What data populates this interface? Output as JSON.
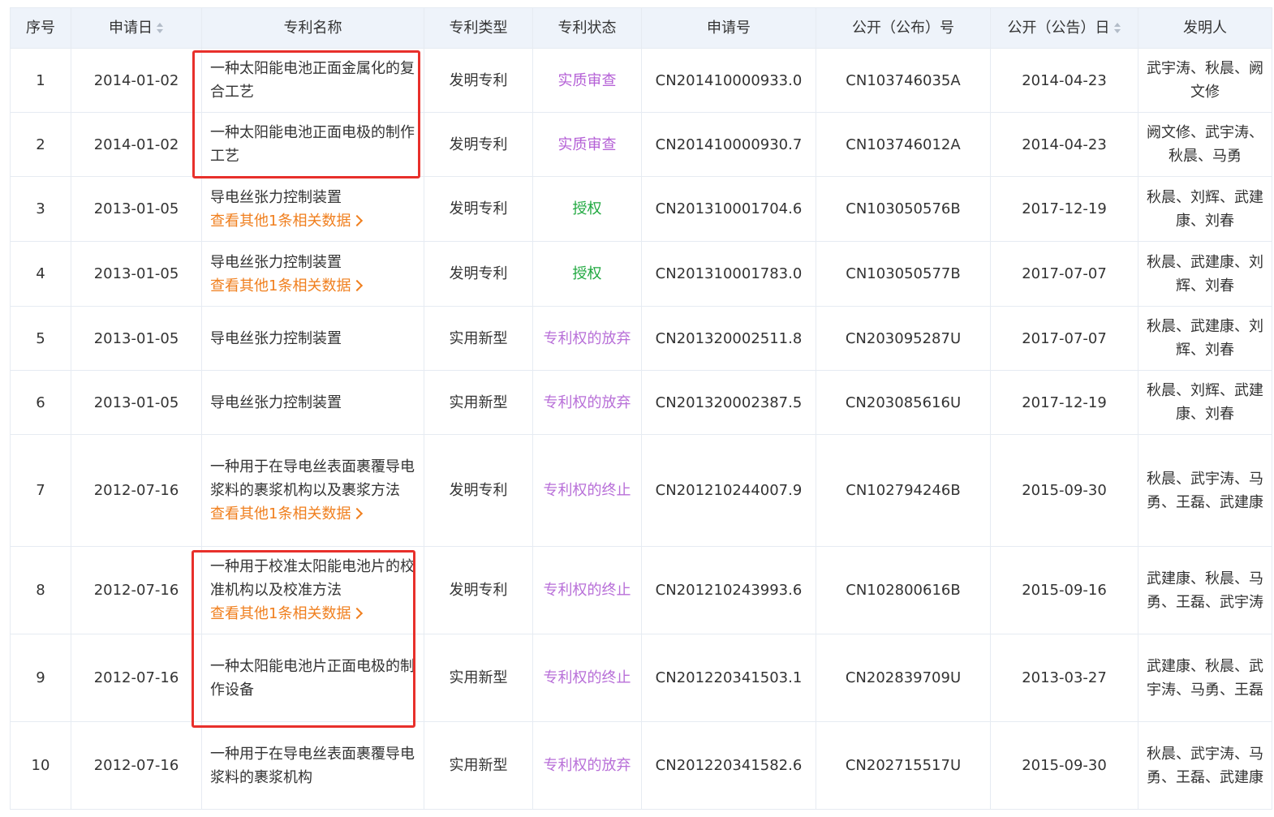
{
  "columns": [
    {
      "label": "序号",
      "sortable": false
    },
    {
      "label": "申请日",
      "sortable": true
    },
    {
      "label": "专利名称",
      "sortable": false
    },
    {
      "label": "专利类型",
      "sortable": false
    },
    {
      "label": "专利状态",
      "sortable": false
    },
    {
      "label": "申请号",
      "sortable": false
    },
    {
      "label": "公开（公布）号",
      "sortable": false
    },
    {
      "label": "公开（公告）日",
      "sortable": true
    },
    {
      "label": "发明人",
      "sortable": false
    }
  ],
  "rows": [
    {
      "no": "1",
      "date": "2014-01-02",
      "name": "一种太阳能电池正面金属化的复合工艺",
      "related": "",
      "type": "发明专利",
      "status": "实质审查",
      "status_kind": "exam",
      "app_no": "CN201410000933.0",
      "pub_no": "CN103746035A",
      "pub_date": "2014-04-23",
      "inventors": "武宇涛、秋晨、阙文修"
    },
    {
      "no": "2",
      "date": "2014-01-02",
      "name": "一种太阳能电池正面电极的制作工艺",
      "related": "",
      "type": "发明专利",
      "status": "实质审查",
      "status_kind": "exam",
      "app_no": "CN201410000930.7",
      "pub_no": "CN103746012A",
      "pub_date": "2014-04-23",
      "inventors": "阙文修、武宇涛、秋晨、马勇"
    },
    {
      "no": "3",
      "date": "2013-01-05",
      "name": "导电丝张力控制装置",
      "related": "查看其他1条相关数据",
      "type": "发明专利",
      "status": "授权",
      "status_kind": "grant",
      "app_no": "CN201310001704.6",
      "pub_no": "CN103050576B",
      "pub_date": "2017-12-19",
      "inventors": "秋晨、刘辉、武建康、刘春"
    },
    {
      "no": "4",
      "date": "2013-01-05",
      "name": "导电丝张力控制装置",
      "related": "查看其他1条相关数据",
      "type": "发明专利",
      "status": "授权",
      "status_kind": "grant",
      "app_no": "CN201310001783.0",
      "pub_no": "CN103050577B",
      "pub_date": "2017-07-07",
      "inventors": "秋晨、武建康、刘辉、刘春"
    },
    {
      "no": "5",
      "date": "2013-01-05",
      "name": "导电丝张力控制装置",
      "related": "",
      "type": "实用新型",
      "status": "专利权的放弃",
      "status_kind": "lapse",
      "app_no": "CN201320002511.8",
      "pub_no": "CN203095287U",
      "pub_date": "2017-07-07",
      "inventors": "秋晨、武建康、刘辉、刘春"
    },
    {
      "no": "6",
      "date": "2013-01-05",
      "name": "导电丝张力控制装置",
      "related": "",
      "type": "实用新型",
      "status": "专利权的放弃",
      "status_kind": "lapse",
      "app_no": "CN201320002387.5",
      "pub_no": "CN203085616U",
      "pub_date": "2017-12-19",
      "inventors": "秋晨、刘辉、武建康、刘春"
    },
    {
      "no": "7",
      "date": "2012-07-16",
      "name": "一种用于在导电丝表面裹覆导电浆料的裹浆机构以及裹浆方法",
      "related": "查看其他1条相关数据",
      "type": "发明专利",
      "status": "专利权的终止",
      "status_kind": "lapse",
      "app_no": "CN201210244007.9",
      "pub_no": "CN102794246B",
      "pub_date": "2015-09-30",
      "inventors": "秋晨、武宇涛、马勇、王磊、武建康"
    },
    {
      "no": "8",
      "date": "2012-07-16",
      "name": "一种用于校准太阳能电池片的校准机构以及校准方法",
      "related": "查看其他1条相关数据",
      "type": "发明专利",
      "status": "专利权的终止",
      "status_kind": "lapse",
      "app_no": "CN201210243993.6",
      "pub_no": "CN102800616B",
      "pub_date": "2015-09-16",
      "inventors": "武建康、秋晨、马勇、王磊、武宇涛"
    },
    {
      "no": "9",
      "date": "2012-07-16",
      "name": "一种太阳能电池片正面电极的制作设备",
      "related": "",
      "type": "实用新型",
      "status": "专利权的终止",
      "status_kind": "lapse",
      "app_no": "CN201220341503.1",
      "pub_no": "CN202839709U",
      "pub_date": "2013-03-27",
      "inventors": "武建康、秋晨、武宇涛、马勇、王磊"
    },
    {
      "no": "10",
      "date": "2012-07-16",
      "name": "一种用于在导电丝表面裹覆导电浆料的裹浆机构",
      "related": "",
      "type": "实用新型",
      "status": "专利权的放弃",
      "status_kind": "lapse",
      "app_no": "CN201220341582.6",
      "pub_no": "CN202715517U",
      "pub_date": "2015-09-30",
      "inventors": "秋晨、武宇涛、马勇、王磊、武建康"
    }
  ],
  "colors": {
    "header_bg": "#eef3fa",
    "border": "#e6ebf2",
    "link": "#f07f1e",
    "status_exam": "#b45fd6",
    "status_grant": "#1fa83f",
    "status_lapse": "#b86fd8",
    "annotation_box": "#e8302b"
  }
}
